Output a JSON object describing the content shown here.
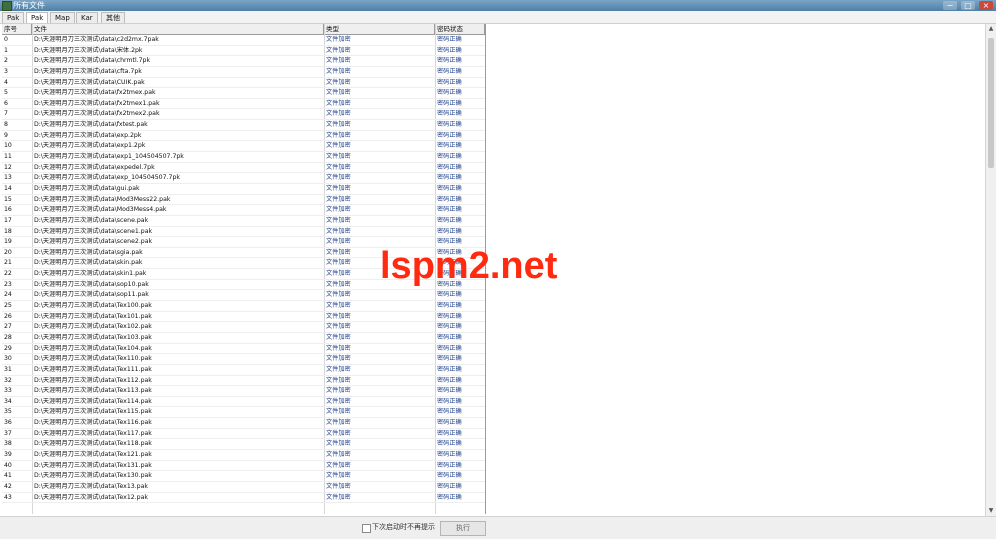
{
  "window": {
    "title": "所有文件",
    "controls": {
      "minimize": "−",
      "maximize": "□",
      "close": "×"
    }
  },
  "tabs": [
    {
      "label": "Pak",
      "active": false
    },
    {
      "label": "Pak",
      "active": true
    },
    {
      "label": "Map",
      "active": false
    },
    {
      "label": "Kar",
      "active": false
    },
    {
      "label": "其他",
      "active": false
    }
  ],
  "table": {
    "headers": [
      "序号",
      "文件",
      "类型",
      "密码状态"
    ],
    "rows": [
      [
        "0",
        "D:\\天涯明月刀三次测试\\data\\c2d2mx.7pak",
        "文件加密",
        "密码正确"
      ],
      [
        "1",
        "D:\\天涯明月刀三次测试\\data\\宋体.2pk",
        "文件加密",
        "密码正确"
      ],
      [
        "2",
        "D:\\天涯明月刀三次测试\\data\\chrmtl.7pk",
        "文件加密",
        "密码正确"
      ],
      [
        "3",
        "D:\\天涯明月刀三次测试\\data\\cfta.7pk",
        "文件加密",
        "密码正确"
      ],
      [
        "4",
        "D:\\天涯明月刀三次测试\\data\\CUIK.pak",
        "文件加密",
        "密码正确"
      ],
      [
        "5",
        "D:\\天涯明月刀三次测试\\data\\fx2tmex.pak",
        "文件加密",
        "密码正确"
      ],
      [
        "6",
        "D:\\天涯明月刀三次测试\\data\\fx2tmex1.pak",
        "文件加密",
        "密码正确"
      ],
      [
        "7",
        "D:\\天涯明月刀三次测试\\data\\fx2tmex2.pak",
        "文件加密",
        "密码正确"
      ],
      [
        "8",
        "D:\\天涯明月刀三次测试\\data\\fxtest.pak",
        "文件加密",
        "密码正确"
      ],
      [
        "9",
        "D:\\天涯明月刀三次测试\\data\\exp.2pk",
        "文件加密",
        "密码正确"
      ],
      [
        "10",
        "D:\\天涯明月刀三次测试\\data\\exp1.2pk",
        "文件加密",
        "密码正确"
      ],
      [
        "11",
        "D:\\天涯明月刀三次测试\\data\\exp1_104504507.7pk",
        "文件加密",
        "密码正确"
      ],
      [
        "12",
        "D:\\天涯明月刀三次测试\\data\\expedel.7pk",
        "文件加密",
        "密码正确"
      ],
      [
        "13",
        "D:\\天涯明月刀三次测试\\data\\exp_104504507.7pk",
        "文件加密",
        "密码正确"
      ],
      [
        "14",
        "D:\\天涯明月刀三次测试\\data\\gui.pak",
        "文件加密",
        "密码正确"
      ],
      [
        "15",
        "D:\\天涯明月刀三次测试\\data\\Mod3Mess22.pak",
        "文件加密",
        "密码正确"
      ],
      [
        "16",
        "D:\\天涯明月刀三次测试\\data\\Mod3Mess4.pak",
        "文件加密",
        "密码正确"
      ],
      [
        "17",
        "D:\\天涯明月刀三次测试\\data\\scene.pak",
        "文件加密",
        "密码正确"
      ],
      [
        "18",
        "D:\\天涯明月刀三次测试\\data\\scene1.pak",
        "文件加密",
        "密码正确"
      ],
      [
        "19",
        "D:\\天涯明月刀三次测试\\data\\scene2.pak",
        "文件加密",
        "密码正确"
      ],
      [
        "20",
        "D:\\天涯明月刀三次测试\\data\\sgia.pak",
        "文件加密",
        "密码正确"
      ],
      [
        "21",
        "D:\\天涯明月刀三次测试\\data\\skin.pak",
        "文件加密",
        "密码正确"
      ],
      [
        "22",
        "D:\\天涯明月刀三次测试\\data\\skin1.pak",
        "文件加密",
        "密码正确"
      ],
      [
        "23",
        "D:\\天涯明月刀三次测试\\data\\sop10.pak",
        "文件加密",
        "密码正确"
      ],
      [
        "24",
        "D:\\天涯明月刀三次测试\\data\\sop11.pak",
        "文件加密",
        "密码正确"
      ],
      [
        "25",
        "D:\\天涯明月刀三次测试\\data\\Tex100.pak",
        "文件加密",
        "密码正确"
      ],
      [
        "26",
        "D:\\天涯明月刀三次测试\\data\\Tex101.pak",
        "文件加密",
        "密码正确"
      ],
      [
        "27",
        "D:\\天涯明月刀三次测试\\data\\Tex102.pak",
        "文件加密",
        "密码正确"
      ],
      [
        "28",
        "D:\\天涯明月刀三次测试\\data\\Tex103.pak",
        "文件加密",
        "密码正确"
      ],
      [
        "29",
        "D:\\天涯明月刀三次测试\\data\\Tex104.pak",
        "文件加密",
        "密码正确"
      ],
      [
        "30",
        "D:\\天涯明月刀三次测试\\data\\Tex110.pak",
        "文件加密",
        "密码正确"
      ],
      [
        "31",
        "D:\\天涯明月刀三次测试\\data\\Tex111.pak",
        "文件加密",
        "密码正确"
      ],
      [
        "32",
        "D:\\天涯明月刀三次测试\\data\\Tex112.pak",
        "文件加密",
        "密码正确"
      ],
      [
        "33",
        "D:\\天涯明月刀三次测试\\data\\Tex113.pak",
        "文件加密",
        "密码正确"
      ],
      [
        "34",
        "D:\\天涯明月刀三次测试\\data\\Tex114.pak",
        "文件加密",
        "密码正确"
      ],
      [
        "35",
        "D:\\天涯明月刀三次测试\\data\\Tex115.pak",
        "文件加密",
        "密码正确"
      ],
      [
        "36",
        "D:\\天涯明月刀三次测试\\data\\Tex116.pak",
        "文件加密",
        "密码正确"
      ],
      [
        "37",
        "D:\\天涯明月刀三次测试\\data\\Tex117.pak",
        "文件加密",
        "密码正确"
      ],
      [
        "38",
        "D:\\天涯明月刀三次测试\\data\\Tex118.pak",
        "文件加密",
        "密码正确"
      ],
      [
        "39",
        "D:\\天涯明月刀三次测试\\data\\Tex121.pak",
        "文件加密",
        "密码正确"
      ],
      [
        "40",
        "D:\\天涯明月刀三次测试\\data\\Tex131.pak",
        "文件加密",
        "密码正确"
      ],
      [
        "41",
        "D:\\天涯明月刀三次测试\\data\\Tex130.pak",
        "文件加密",
        "密码正确"
      ],
      [
        "42",
        "D:\\天涯明月刀三次测试\\data\\Tex13.pak",
        "文件加密",
        "密码正确"
      ],
      [
        "43",
        "D:\\天涯明月刀三次测试\\data\\Tex12.pak",
        "文件加密",
        "密码正确"
      ]
    ]
  },
  "footer": {
    "checkbox_label": "下次启动时不再提示",
    "execute_label": "执行"
  },
  "watermark": "lspm2.net",
  "colors": {
    "titlebar": "#4e7fa6",
    "link_text": "#1d3f8a",
    "watermark": "#ff2a0f"
  }
}
